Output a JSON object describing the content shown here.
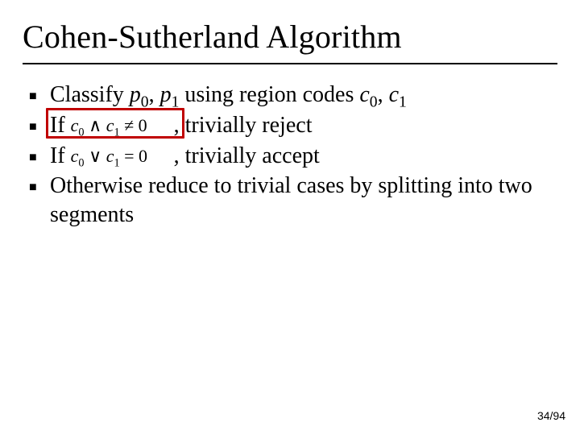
{
  "title": "Cohen-Sutherland Algorithm",
  "bullets": {
    "b1": {
      "pre": "Classify ",
      "p0": "p",
      "p0s": "0",
      "c1": ", ",
      "p1": "p",
      "p1s": "1",
      "mid": " using region codes ",
      "c0": "c",
      "c0s": "0",
      "c2": ", ",
      "c1v": "c",
      "c1s": "1"
    },
    "b2": {
      "if": "If ",
      "formula_c0": "c",
      "formula_c0s": "0",
      "and": " ∧ ",
      "formula_c1": "c",
      "formula_c1s": "1",
      "neq": " ≠ 0",
      "tail": ", trivially reject"
    },
    "b3": {
      "if": "If ",
      "formula_c0": "c",
      "formula_c0s": "0",
      "or": " ∨ ",
      "formula_c1": "c",
      "formula_c1s": "1",
      "eq": " = 0",
      "tail": ", trivially accept"
    },
    "b4": "Otherwise reduce to trivial cases by splitting into two segments"
  },
  "page": "34/94",
  "sq": "■"
}
